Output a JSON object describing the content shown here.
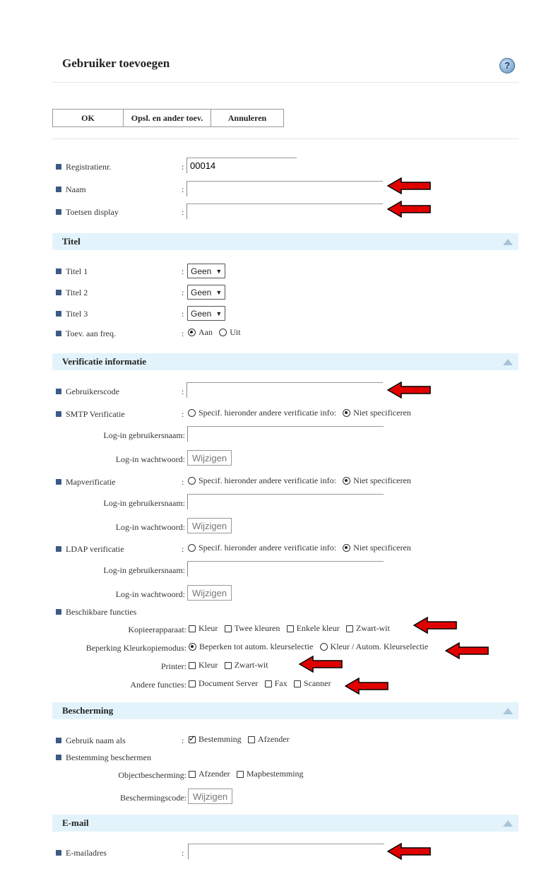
{
  "header": {
    "title": "Gebruiker toevoegen",
    "help_icon": "?"
  },
  "toolbar": {
    "ok": "OK",
    "save_add": "Opsl. en ander toev.",
    "cancel": "Annuleren"
  },
  "basic": {
    "reg_label": "Registratienr.",
    "reg_value": "00014",
    "name_label": "Naam",
    "name_value": "",
    "keydisplay_label": "Toetsen display",
    "keydisplay_value": ""
  },
  "titel_section": {
    "heading": "Titel",
    "titel1_label": "Titel 1",
    "titel1_value": "Geen",
    "titel2_label": "Titel 2",
    "titel2_value": "Geen",
    "titel3_label": "Titel 3",
    "titel3_value": "Geen",
    "freq_label": "Toev. aan freq.",
    "freq_on": "Aan",
    "freq_off": "Uit",
    "freq_selected": "Aan"
  },
  "verificatie": {
    "heading": "Verificatie informatie",
    "usercode_label": "Gebruikerscode",
    "usercode_value": "",
    "smtp_label": "SMTP Verificatie",
    "map_label": "Mapverificatie",
    "ldap_label": "LDAP verificatie",
    "opt_specify": "Specif. hieronder andere verificatie info:",
    "opt_none": "Niet specificeren",
    "login_user_label": "Log-in gebruikersnaam:",
    "login_pass_label": "Log-in wachtwoord:",
    "change_button": "Wijzigen",
    "functions_label": "Beschikbare functies",
    "copier_label": "Kopieerapparaat:",
    "copier_opts": [
      "Kleur",
      "Twee kleuren",
      "Enkele kleur",
      "Zwart-wit"
    ],
    "colorlimit_label": "Beperking Kleurkopiemodus:",
    "colorlimit_opt1": "Beperken tot autom. kleurselectie",
    "colorlimit_opt2": "Kleur / Autom. Kleurselectie",
    "printer_label": "Printer:",
    "printer_opts": [
      "Kleur",
      "Zwart-wit"
    ],
    "other_label": "Andere functies:",
    "other_opts": [
      "Document Server",
      "Fax",
      "Scanner"
    ]
  },
  "bescherming": {
    "heading": "Bescherming",
    "use_name_label": "Gebruik naam als",
    "opt_destination": "Bestemming",
    "opt_sender": "Afzender",
    "protect_dest_label": "Bestemming beschermen",
    "object_label": "Objectbescherming:",
    "object_opts": [
      "Afzender",
      "Mapbestemming"
    ],
    "code_label": "Beschermingscode:",
    "change_button": "Wijzigen"
  },
  "email": {
    "heading": "E-mail",
    "address_label": "E-mailadres",
    "address_value": ""
  },
  "colors": {
    "section_bg": "#e3f3fb",
    "bullet": "#3d5a85",
    "arrow": "#e00000"
  }
}
